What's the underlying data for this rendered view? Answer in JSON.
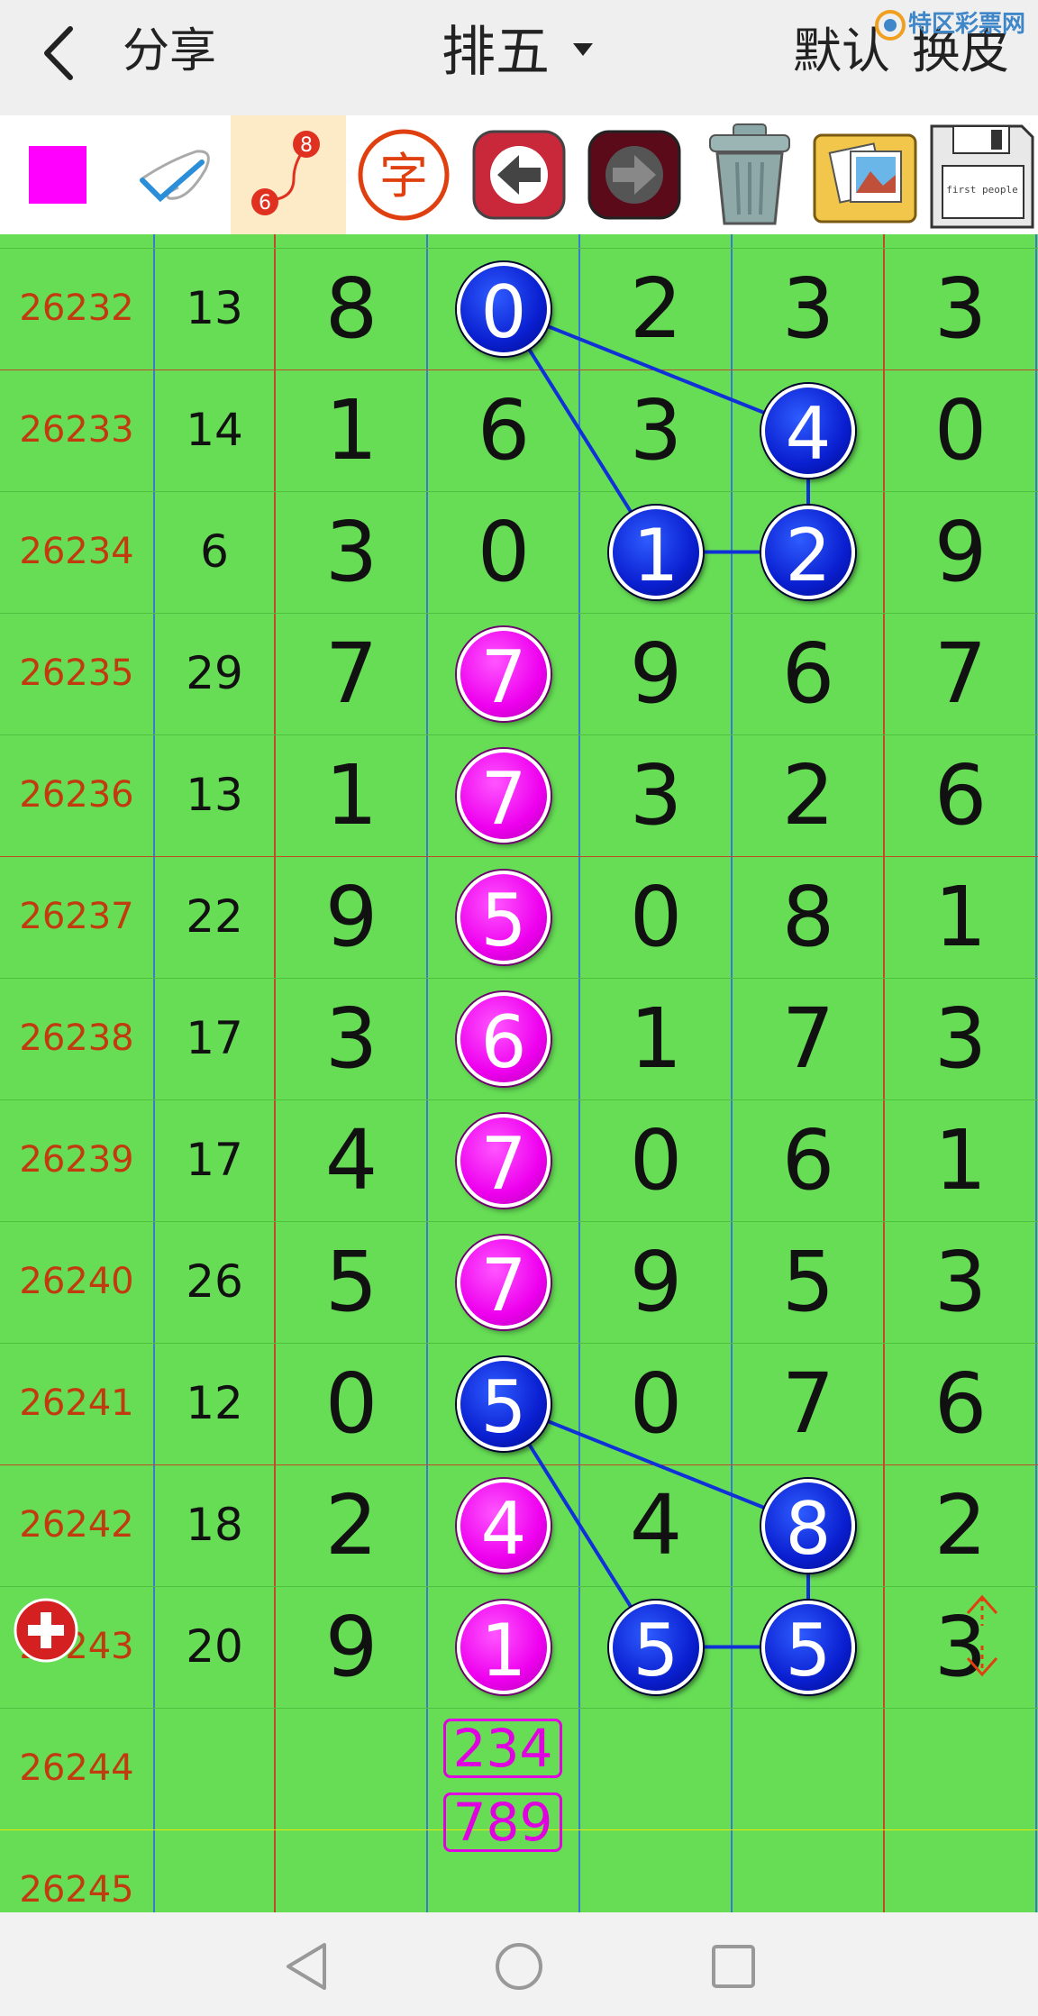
{
  "header": {
    "back_label": "<",
    "share_label": "分享",
    "title": "排五",
    "default_label": "默认",
    "skin_label": "换皮",
    "watermark_text": "特区彩票网"
  },
  "toolbar": {
    "items": [
      {
        "name": "color-swatch",
        "color": "#ff00ff"
      },
      {
        "name": "pen-tool"
      },
      {
        "name": "connect-tool",
        "labels": [
          "8",
          "6"
        ]
      },
      {
        "name": "text-tool",
        "label": "字"
      },
      {
        "name": "undo-arrow"
      },
      {
        "name": "redo-arrow"
      },
      {
        "name": "trash"
      },
      {
        "name": "gallery"
      },
      {
        "name": "save-disk",
        "label": "first people"
      }
    ]
  },
  "colors": {
    "grid_bg": "#66dd55",
    "period_text": "#c23a10",
    "ball_blue": "#0a1fd0",
    "ball_magenta": "#ee00ee",
    "separator_red": "#c04a2a",
    "separator_blue": "#3a7ad0"
  },
  "rows": [
    {
      "period": "26232",
      "sum": "13",
      "digits": [
        "8",
        "0",
        "2",
        "3",
        "3"
      ]
    },
    {
      "period": "26233",
      "sum": "14",
      "digits": [
        "1",
        "6",
        "3",
        "4",
        "0"
      ]
    },
    {
      "period": "26234",
      "sum": "6",
      "digits": [
        "3",
        "0",
        "1",
        "2",
        "9"
      ]
    },
    {
      "period": "26235",
      "sum": "29",
      "digits": [
        "7",
        "7",
        "9",
        "6",
        "7"
      ]
    },
    {
      "period": "26236",
      "sum": "13",
      "digits": [
        "1",
        "7",
        "3",
        "2",
        "6"
      ]
    },
    {
      "period": "26237",
      "sum": "22",
      "digits": [
        "9",
        "5",
        "0",
        "8",
        "1"
      ]
    },
    {
      "period": "26238",
      "sum": "17",
      "digits": [
        "3",
        "6",
        "1",
        "7",
        "3"
      ]
    },
    {
      "period": "26239",
      "sum": "17",
      "digits": [
        "4",
        "7",
        "0",
        "6",
        "1"
      ]
    },
    {
      "period": "26240",
      "sum": "26",
      "digits": [
        "5",
        "7",
        "9",
        "5",
        "3"
      ]
    },
    {
      "period": "26241",
      "sum": "12",
      "digits": [
        "0",
        "5",
        "0",
        "7",
        "6"
      ]
    },
    {
      "period": "26242",
      "sum": "18",
      "digits": [
        "2",
        "4",
        "4",
        "8",
        "2"
      ]
    },
    {
      "period": "26243",
      "sum": "20",
      "digits": [
        "9",
        "1",
        "5",
        "5",
        "3"
      ]
    },
    {
      "period": "26244",
      "sum": "",
      "digits": [
        "",
        "",
        "",
        "",
        ""
      ]
    },
    {
      "period": "26245",
      "sum": "",
      "digits": [
        "",
        "",
        "",
        "",
        ""
      ]
    }
  ],
  "highlights": [
    {
      "row": 0,
      "col": 1,
      "style": "blue"
    },
    {
      "row": 1,
      "col": 3,
      "style": "blue"
    },
    {
      "row": 2,
      "col": 2,
      "style": "blue"
    },
    {
      "row": 2,
      "col": 3,
      "style": "blue"
    },
    {
      "row": 3,
      "col": 1,
      "style": "magenta"
    },
    {
      "row": 4,
      "col": 1,
      "style": "magenta"
    },
    {
      "row": 5,
      "col": 1,
      "style": "magenta"
    },
    {
      "row": 6,
      "col": 1,
      "style": "magenta"
    },
    {
      "row": 7,
      "col": 1,
      "style": "magenta"
    },
    {
      "row": 8,
      "col": 1,
      "style": "magenta"
    },
    {
      "row": 9,
      "col": 1,
      "style": "blue"
    },
    {
      "row": 10,
      "col": 1,
      "style": "magenta"
    },
    {
      "row": 10,
      "col": 3,
      "style": "blue"
    },
    {
      "row": 11,
      "col": 1,
      "style": "magenta"
    },
    {
      "row": 11,
      "col": 2,
      "style": "blue"
    },
    {
      "row": 11,
      "col": 3,
      "style": "blue"
    }
  ],
  "connections": [
    [
      [
        0,
        1
      ],
      [
        1,
        3
      ]
    ],
    [
      [
        0,
        1
      ],
      [
        2,
        2
      ]
    ],
    [
      [
        2,
        2
      ],
      [
        2,
        3
      ]
    ],
    [
      [
        1,
        3
      ],
      [
        2,
        3
      ]
    ],
    [
      [
        9,
        1
      ],
      [
        10,
        3
      ]
    ],
    [
      [
        9,
        1
      ],
      [
        11,
        2
      ]
    ],
    [
      [
        11,
        2
      ],
      [
        11,
        3
      ]
    ],
    [
      [
        10,
        3
      ],
      [
        11,
        3
      ]
    ]
  ],
  "predictions": {
    "row": 12,
    "col": 1,
    "values": [
      "234",
      "789"
    ]
  },
  "controls": {
    "add_icon": "plus-icon",
    "scroll_icon": "up-down-icon"
  },
  "navbar": {
    "icons": [
      "back-triangle-icon",
      "home-circle-icon",
      "recents-square-icon"
    ]
  }
}
